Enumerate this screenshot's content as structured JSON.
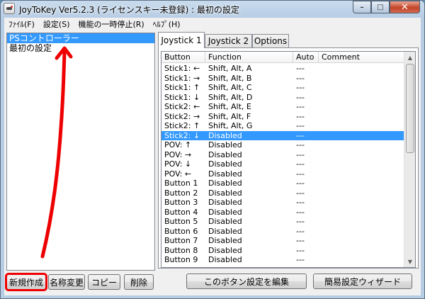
{
  "window": {
    "title": "JoyToKey Ver5.2.3 (ライセンスキー未登録) : 最初の設定",
    "caption": {
      "minimize": "–",
      "maximize": "□",
      "close": "✕"
    }
  },
  "menu": [
    {
      "label": "ﾌｧｲﾙ(F)"
    },
    {
      "label": "設定(S)"
    },
    {
      "label": "機能の一時停止(R)"
    },
    {
      "label": "ﾍﾙﾌﾟ(H)"
    }
  ],
  "profiles": [
    {
      "label": "PSコントローラー",
      "selected": true
    },
    {
      "label": "最初の設定",
      "selected": false
    }
  ],
  "profile_buttons": {
    "new": "新規作成",
    "rename": "名称変更",
    "copy": "コピー",
    "delete": "削除"
  },
  "tabs": [
    {
      "label": "Joystick 1",
      "active": true
    },
    {
      "label": "Joystick 2",
      "active": false
    },
    {
      "label": "Options",
      "active": false
    }
  ],
  "columns": {
    "button": "Button",
    "function": "Function",
    "auto": "Auto",
    "comment": "Comment"
  },
  "rows": [
    {
      "button": "Stick1: ←",
      "function": "Shift, Alt, A",
      "auto": "---",
      "comment": "",
      "selected": false
    },
    {
      "button": "Stick1: →",
      "function": "Shift, Alt, B",
      "auto": "---",
      "comment": "",
      "selected": false
    },
    {
      "button": "Stick1: ↑",
      "function": "Shift, Alt, C",
      "auto": "---",
      "comment": "",
      "selected": false
    },
    {
      "button": "Stick1: ↓",
      "function": "Shift, Alt, D",
      "auto": "---",
      "comment": "",
      "selected": false
    },
    {
      "button": "Stick2: ←",
      "function": "Shift, Alt, E",
      "auto": "---",
      "comment": "",
      "selected": false
    },
    {
      "button": "Stick2: →",
      "function": "Shift, Alt, F",
      "auto": "---",
      "comment": "",
      "selected": false
    },
    {
      "button": "Stick2: ↑",
      "function": "Shift, Alt, G",
      "auto": "---",
      "comment": "",
      "selected": false
    },
    {
      "button": "Stick2: ↓",
      "function": "Disabled",
      "auto": "---",
      "comment": "",
      "selected": true
    },
    {
      "button": "POV: ↑",
      "function": "Disabled",
      "auto": "---",
      "comment": "",
      "selected": false
    },
    {
      "button": "POV: →",
      "function": "Disabled",
      "auto": "---",
      "comment": "",
      "selected": false
    },
    {
      "button": "POV: ↓",
      "function": "Disabled",
      "auto": "---",
      "comment": "",
      "selected": false
    },
    {
      "button": "POV: ←",
      "function": "Disabled",
      "auto": "---",
      "comment": "",
      "selected": false
    },
    {
      "button": "Button 1",
      "function": "Disabled",
      "auto": "---",
      "comment": "",
      "selected": false
    },
    {
      "button": "Button 2",
      "function": "Disabled",
      "auto": "---",
      "comment": "",
      "selected": false
    },
    {
      "button": "Button 3",
      "function": "Disabled",
      "auto": "---",
      "comment": "",
      "selected": false
    },
    {
      "button": "Button 4",
      "function": "Disabled",
      "auto": "---",
      "comment": "",
      "selected": false
    },
    {
      "button": "Button 5",
      "function": "Disabled",
      "auto": "---",
      "comment": "",
      "selected": false
    },
    {
      "button": "Button 6",
      "function": "Disabled",
      "auto": "---",
      "comment": "",
      "selected": false
    },
    {
      "button": "Button 7",
      "function": "Disabled",
      "auto": "---",
      "comment": "",
      "selected": false
    },
    {
      "button": "Button 8",
      "function": "Disabled",
      "auto": "---",
      "comment": "",
      "selected": false
    },
    {
      "button": "Button 9",
      "function": "Disabled",
      "auto": "---",
      "comment": "",
      "selected": false
    }
  ],
  "bottom_buttons": {
    "edit": "このボタン設定を編集",
    "wizard": "簡易設定ウィザード"
  },
  "colors": {
    "selection": "#3399ff",
    "annotation": "#ee0000"
  }
}
